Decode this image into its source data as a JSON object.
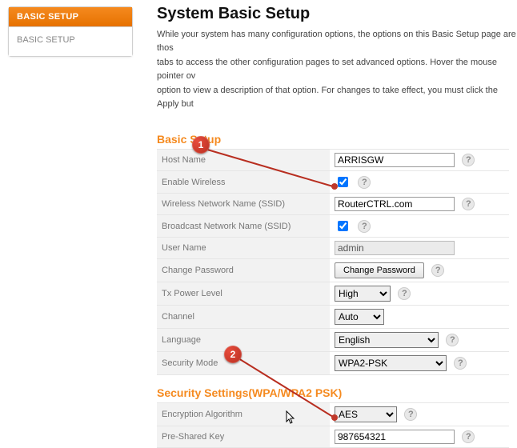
{
  "sidebar": {
    "active": "BASIC SETUP",
    "item": "BASIC SETUP"
  },
  "page": {
    "title": "System Basic Setup",
    "intro1": "While your system has many configuration options, the options on this Basic Setup page are thos",
    "intro2": "tabs to access the other configuration pages to set advanced options. Hover the mouse pointer ov",
    "intro3": "option to view a description of that option. For changes to take effect, you must click the Apply but"
  },
  "sections": {
    "basic": "Basic Setup",
    "security": "Security Settings(WPA/WPA2 PSK)"
  },
  "form": {
    "host_name": {
      "label": "Host Name",
      "value": "ARRISGW"
    },
    "enable_wireless": {
      "label": "Enable Wireless",
      "checked": true
    },
    "ssid": {
      "label": "Wireless Network Name (SSID)",
      "value": "RouterCTRL.com"
    },
    "broadcast": {
      "label": "Broadcast Network Name (SSID)",
      "checked": true
    },
    "user_name": {
      "label": "User Name",
      "value": "admin"
    },
    "change_password": {
      "label": "Change Password",
      "button": "Change Password"
    },
    "tx_power": {
      "label": "Tx Power Level",
      "value": "High"
    },
    "channel": {
      "label": "Channel",
      "value": "Auto"
    },
    "language": {
      "label": "Language",
      "value": "English"
    },
    "security_mode": {
      "label": "Security Mode",
      "value": "WPA2-PSK"
    },
    "encryption": {
      "label": "Encryption Algorithm",
      "value": "AES"
    },
    "psk": {
      "label": "Pre-Shared Key",
      "value": "987654321"
    }
  },
  "callouts": {
    "one": "1",
    "two": "2"
  },
  "help_glyph": "?"
}
